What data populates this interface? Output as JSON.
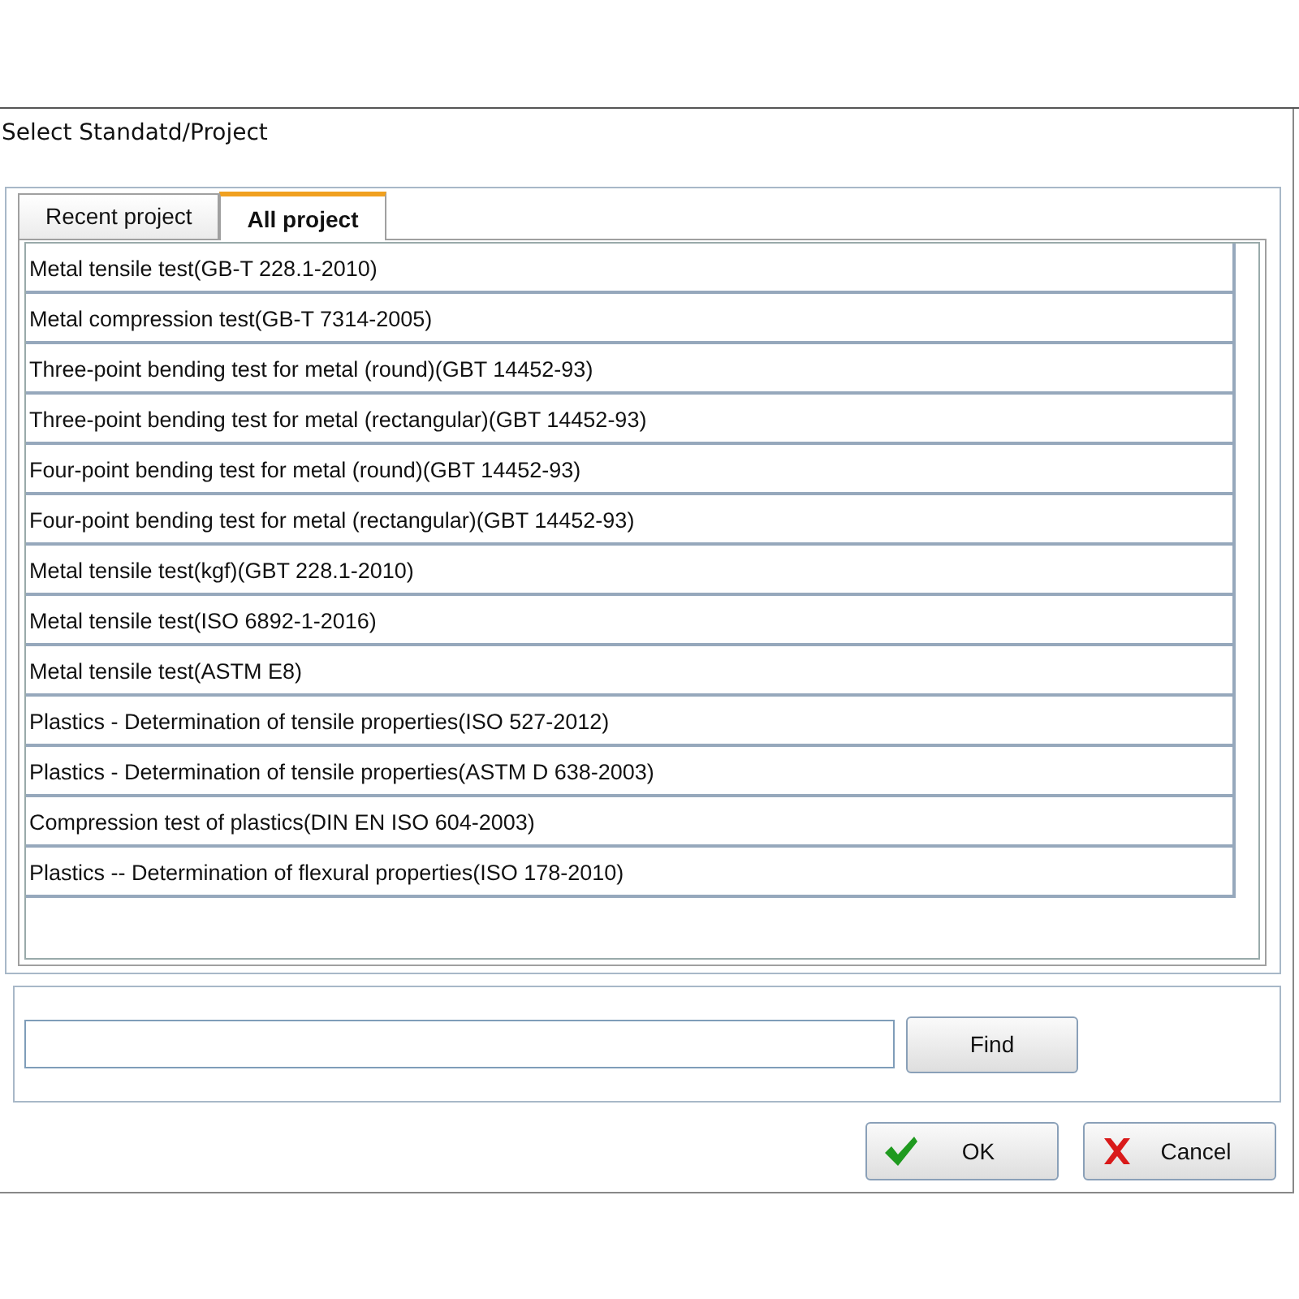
{
  "window": {
    "title": "Select Standatd/Project"
  },
  "tabs": [
    {
      "label": "Recent project",
      "selected": false
    },
    {
      "label": "All project",
      "selected": true
    }
  ],
  "projects": [
    "Metal tensile test(GB-T 228.1-2010)",
    "Metal compression test(GB-T 7314-2005)",
    "Three-point bending test for metal (round)(GBT 14452-93)",
    "Three-point bending test for metal (rectangular)(GBT 14452-93)",
    "Four-point bending test for metal (round)(GBT 14452-93)",
    "Four-point bending test for metal (rectangular)(GBT 14452-93)",
    "Metal tensile test(kgf)(GBT 228.1-2010)",
    "Metal tensile test(ISO 6892-1-2016)",
    "Metal tensile test(ASTM E8)",
    "Plastics - Determination of tensile properties(ISO 527-2012)",
    "Plastics - Determination of tensile properties(ASTM D 638-2003)",
    "Compression test of plastics(DIN EN ISO 604-2003)",
    "Plastics -- Determination of flexural properties(ISO 178-2010)"
  ],
  "search": {
    "button": "Find"
  },
  "buttons": [
    {
      "kind": "ok",
      "label": "OK"
    },
    {
      "kind": "cancel",
      "label": "Cancel"
    }
  ]
}
